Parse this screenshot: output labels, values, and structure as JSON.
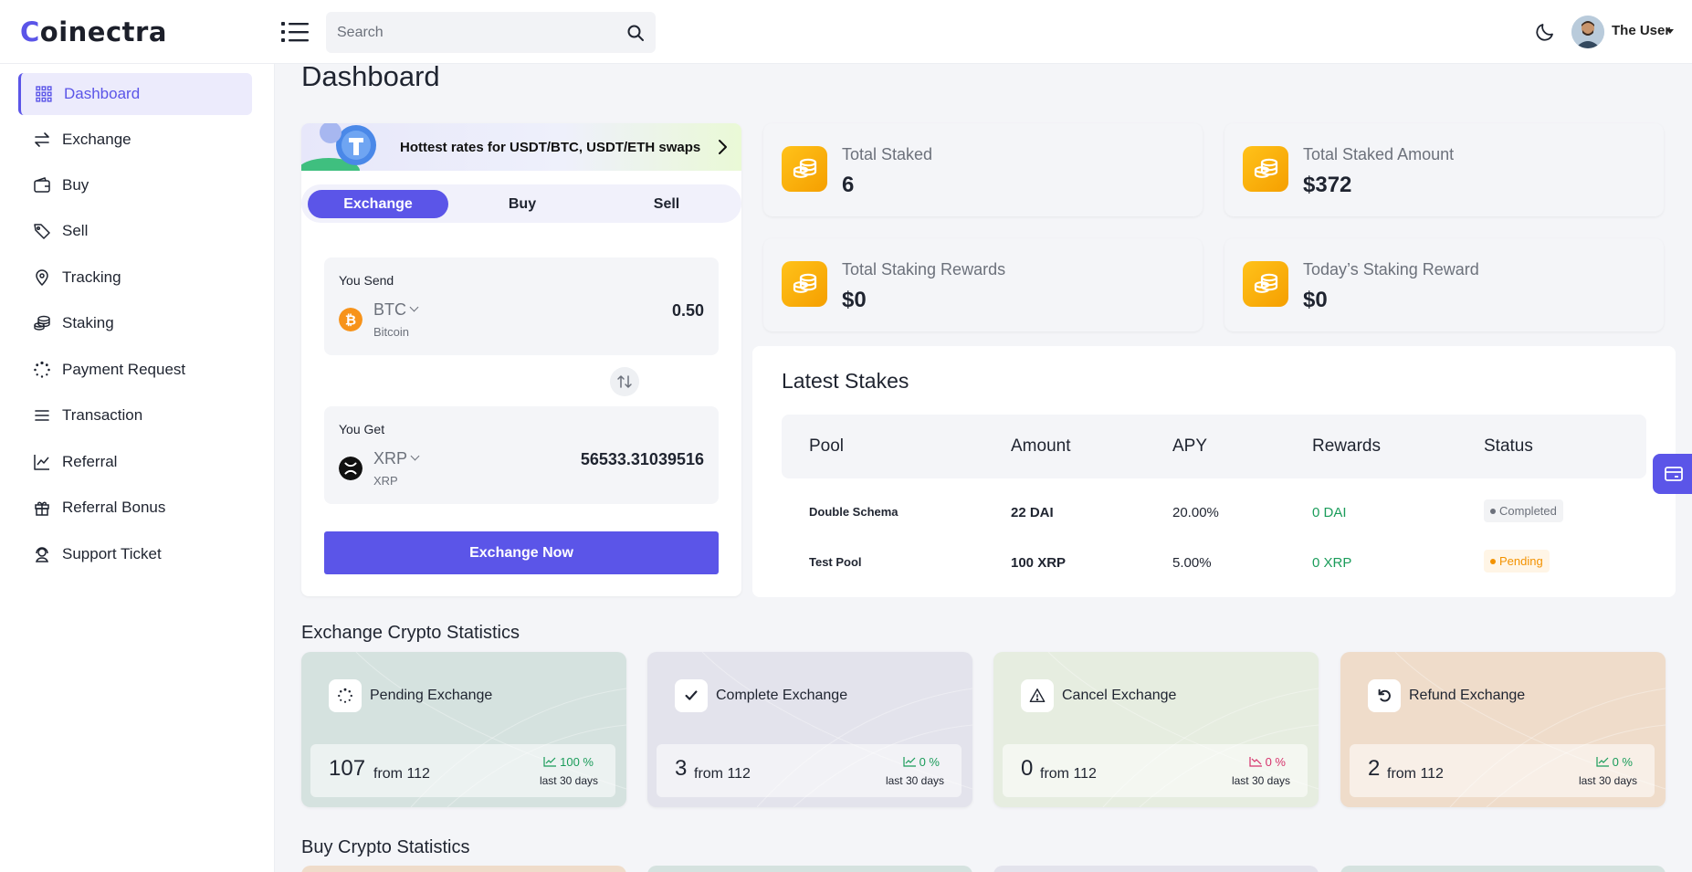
{
  "header": {
    "logo_text": "oinectra",
    "logo_mark": "C",
    "search_placeholder": "Search",
    "user_name": "The User"
  },
  "sidebar": {
    "items": [
      {
        "label": "Dashboard",
        "icon": "grid-icon",
        "active": true
      },
      {
        "label": "Exchange",
        "icon": "arrows-exchange-icon"
      },
      {
        "label": "Buy",
        "icon": "wallet-icon"
      },
      {
        "label": "Sell",
        "icon": "tag-icon"
      },
      {
        "label": "Tracking",
        "icon": "location-pin-icon"
      },
      {
        "label": "Staking",
        "icon": "coins-stack-icon"
      },
      {
        "label": "Payment Request",
        "icon": "loader-dots-icon"
      },
      {
        "label": "Transaction",
        "icon": "list-lines-icon"
      },
      {
        "label": "Referral",
        "icon": "chart-line-icon"
      },
      {
        "label": "Referral Bonus",
        "icon": "gift-icon"
      },
      {
        "label": "Support Ticket",
        "icon": "support-agent-icon"
      }
    ]
  },
  "page": {
    "title": "Dashboard"
  },
  "exchange_widget": {
    "promo_text": "Hottest rates for USDT/BTC, USDT/ETH swaps",
    "tabs": [
      "Exchange",
      "Buy",
      "Sell"
    ],
    "send": {
      "label": "You Send",
      "coin": "BTC",
      "coin_name": "Bitcoin",
      "amount": "0.50",
      "color": "#f7931a"
    },
    "get": {
      "label": "You Get",
      "coin": "XRP",
      "coin_name": "XRP",
      "amount": "56533.31039516",
      "color": "#111111"
    },
    "button_label": "Exchange Now"
  },
  "stats": [
    {
      "label": "Total Staked",
      "value": "6"
    },
    {
      "label": "Total Staked Amount",
      "value": "$372"
    },
    {
      "label": "Total Staking Rewards",
      "value": "$0"
    },
    {
      "label": "Today’s Staking Reward",
      "value": "$0"
    }
  ],
  "latest_stakes": {
    "title": "Latest Stakes",
    "columns": [
      "Pool",
      "Amount",
      "APY",
      "Rewards",
      "Status"
    ],
    "rows": [
      {
        "pool": "Double Schema",
        "amount": "22 DAI",
        "apy": "20.00%",
        "rewards": "0 DAI",
        "status": "Completed"
      },
      {
        "pool": "Test Pool",
        "amount": "100 XRP",
        "apy": "5.00%",
        "rewards": "0 XRP",
        "status": "Pending"
      }
    ]
  },
  "exchange_stats": {
    "title": "Exchange Crypto Statistics",
    "cards": [
      {
        "label": "Pending Exchange",
        "count": "107",
        "from": "from 112",
        "pct": "100 %",
        "trend": "up",
        "period": "last 30 days",
        "bg": "#d5e2df"
      },
      {
        "label": "Complete Exchange",
        "count": "3",
        "from": "from 112",
        "pct": "0 %",
        "trend": "up",
        "period": "last 30 days",
        "bg": "#e3e3ec"
      },
      {
        "label": "Cancel Exchange",
        "count": "0",
        "from": "from 112",
        "pct": "0 %",
        "trend": "down",
        "period": "last 30 days",
        "bg": "#e6ede0"
      },
      {
        "label": "Refund Exchange",
        "count": "2",
        "from": "from 112",
        "pct": "0 %",
        "trend": "up",
        "period": "last 30 days",
        "bg": "#efdcca"
      }
    ]
  },
  "buy_stats": {
    "title": "Buy Crypto Statistics"
  },
  "colors": {
    "accent": "#5b55e8",
    "up": "#1a9c5a",
    "down": "#d6336c"
  }
}
